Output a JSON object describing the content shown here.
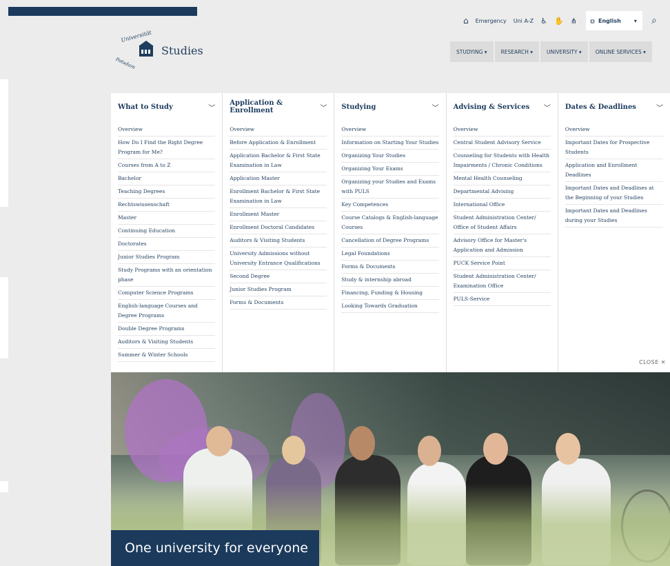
{
  "utility": {
    "emergency": "Emergency",
    "uni_az": "Uni A-Z",
    "language": "English"
  },
  "logo": {
    "arc_text": "Universität Potsdam",
    "title": "Studies"
  },
  "main_nav": [
    "STUDYING ▾",
    "RESEARCH ▾",
    "UNIVERSITY ▾",
    "ONLINE SERVICES ▾"
  ],
  "mega_menu": {
    "columns": [
      {
        "heading": "What to Study",
        "items": [
          "Overview",
          "How Do I Find the Right Degree Program for Me?",
          "Courses from A to Z",
          "Bachelor",
          "Teaching Degrees",
          "Rechtswissenschaft",
          "Master",
          "Continuing Education",
          "Doctorates",
          "Junior Studies Program",
          "Study Programs with an orientation phase",
          "Computer Science Programs",
          "English-language Courses and Degree Programs",
          "Double Degree Programs",
          "Auditors & Visiting Students",
          "Summer & Winter Schools"
        ]
      },
      {
        "heading": "Application & Enrollment",
        "items": [
          "Overview",
          "Before Application & Enrollment",
          "Application Bachelor & First State Examination in Law",
          "Application Master",
          "Enrollment Bachelor & First State Examination in Law",
          "Enrollment Master",
          "Enrollment Doctoral Candidates",
          "Auditors & Visiting Students",
          "University Admissions without University Entrance Qualifications",
          "Second Degree",
          "Junior Studies Program",
          "Forms & Documents"
        ]
      },
      {
        "heading": "Studying",
        "items": [
          "Overview",
          "Information on Starting Your Studies",
          "Organizing Your Studies",
          "Organizing Your Exams",
          "Organizing your Studies and Exams with PULS",
          "Key Competences",
          "Course Catalogs & English-language Courses",
          "Cancellation of Degree Programs",
          "Legal Foundations",
          "Forms & Documents",
          "Study & internship abroad",
          "Financing, Funding & Housing",
          "Looking Towards Graduation"
        ]
      },
      {
        "heading": "Advising & Services",
        "items": [
          "Overview",
          "Central Student Advisory Service",
          "Counseling for Students with Health Impairments / Chronic Conditions",
          "Mental Health Counseling",
          "Departmental Advising",
          "International Office",
          "Student Administration Center/ Office of Student Affairs",
          "Advisory Office for Master's Application and Admission",
          "PUCK Service Point",
          "Student Administration Center/ Examination Office",
          "PULS-Service"
        ]
      },
      {
        "heading": "Dates & Deadlines",
        "items": [
          "Overview",
          "Important Dates for Prospective Students",
          "Application and Enrollment Deadlines",
          "Important Dates and Deadlines at the Beginning of your Studies",
          "Important Dates and Deadlines during your Studies"
        ]
      }
    ],
    "close_label": "CLOSE ✕"
  },
  "hero": {
    "caption": "One university for everyone"
  }
}
